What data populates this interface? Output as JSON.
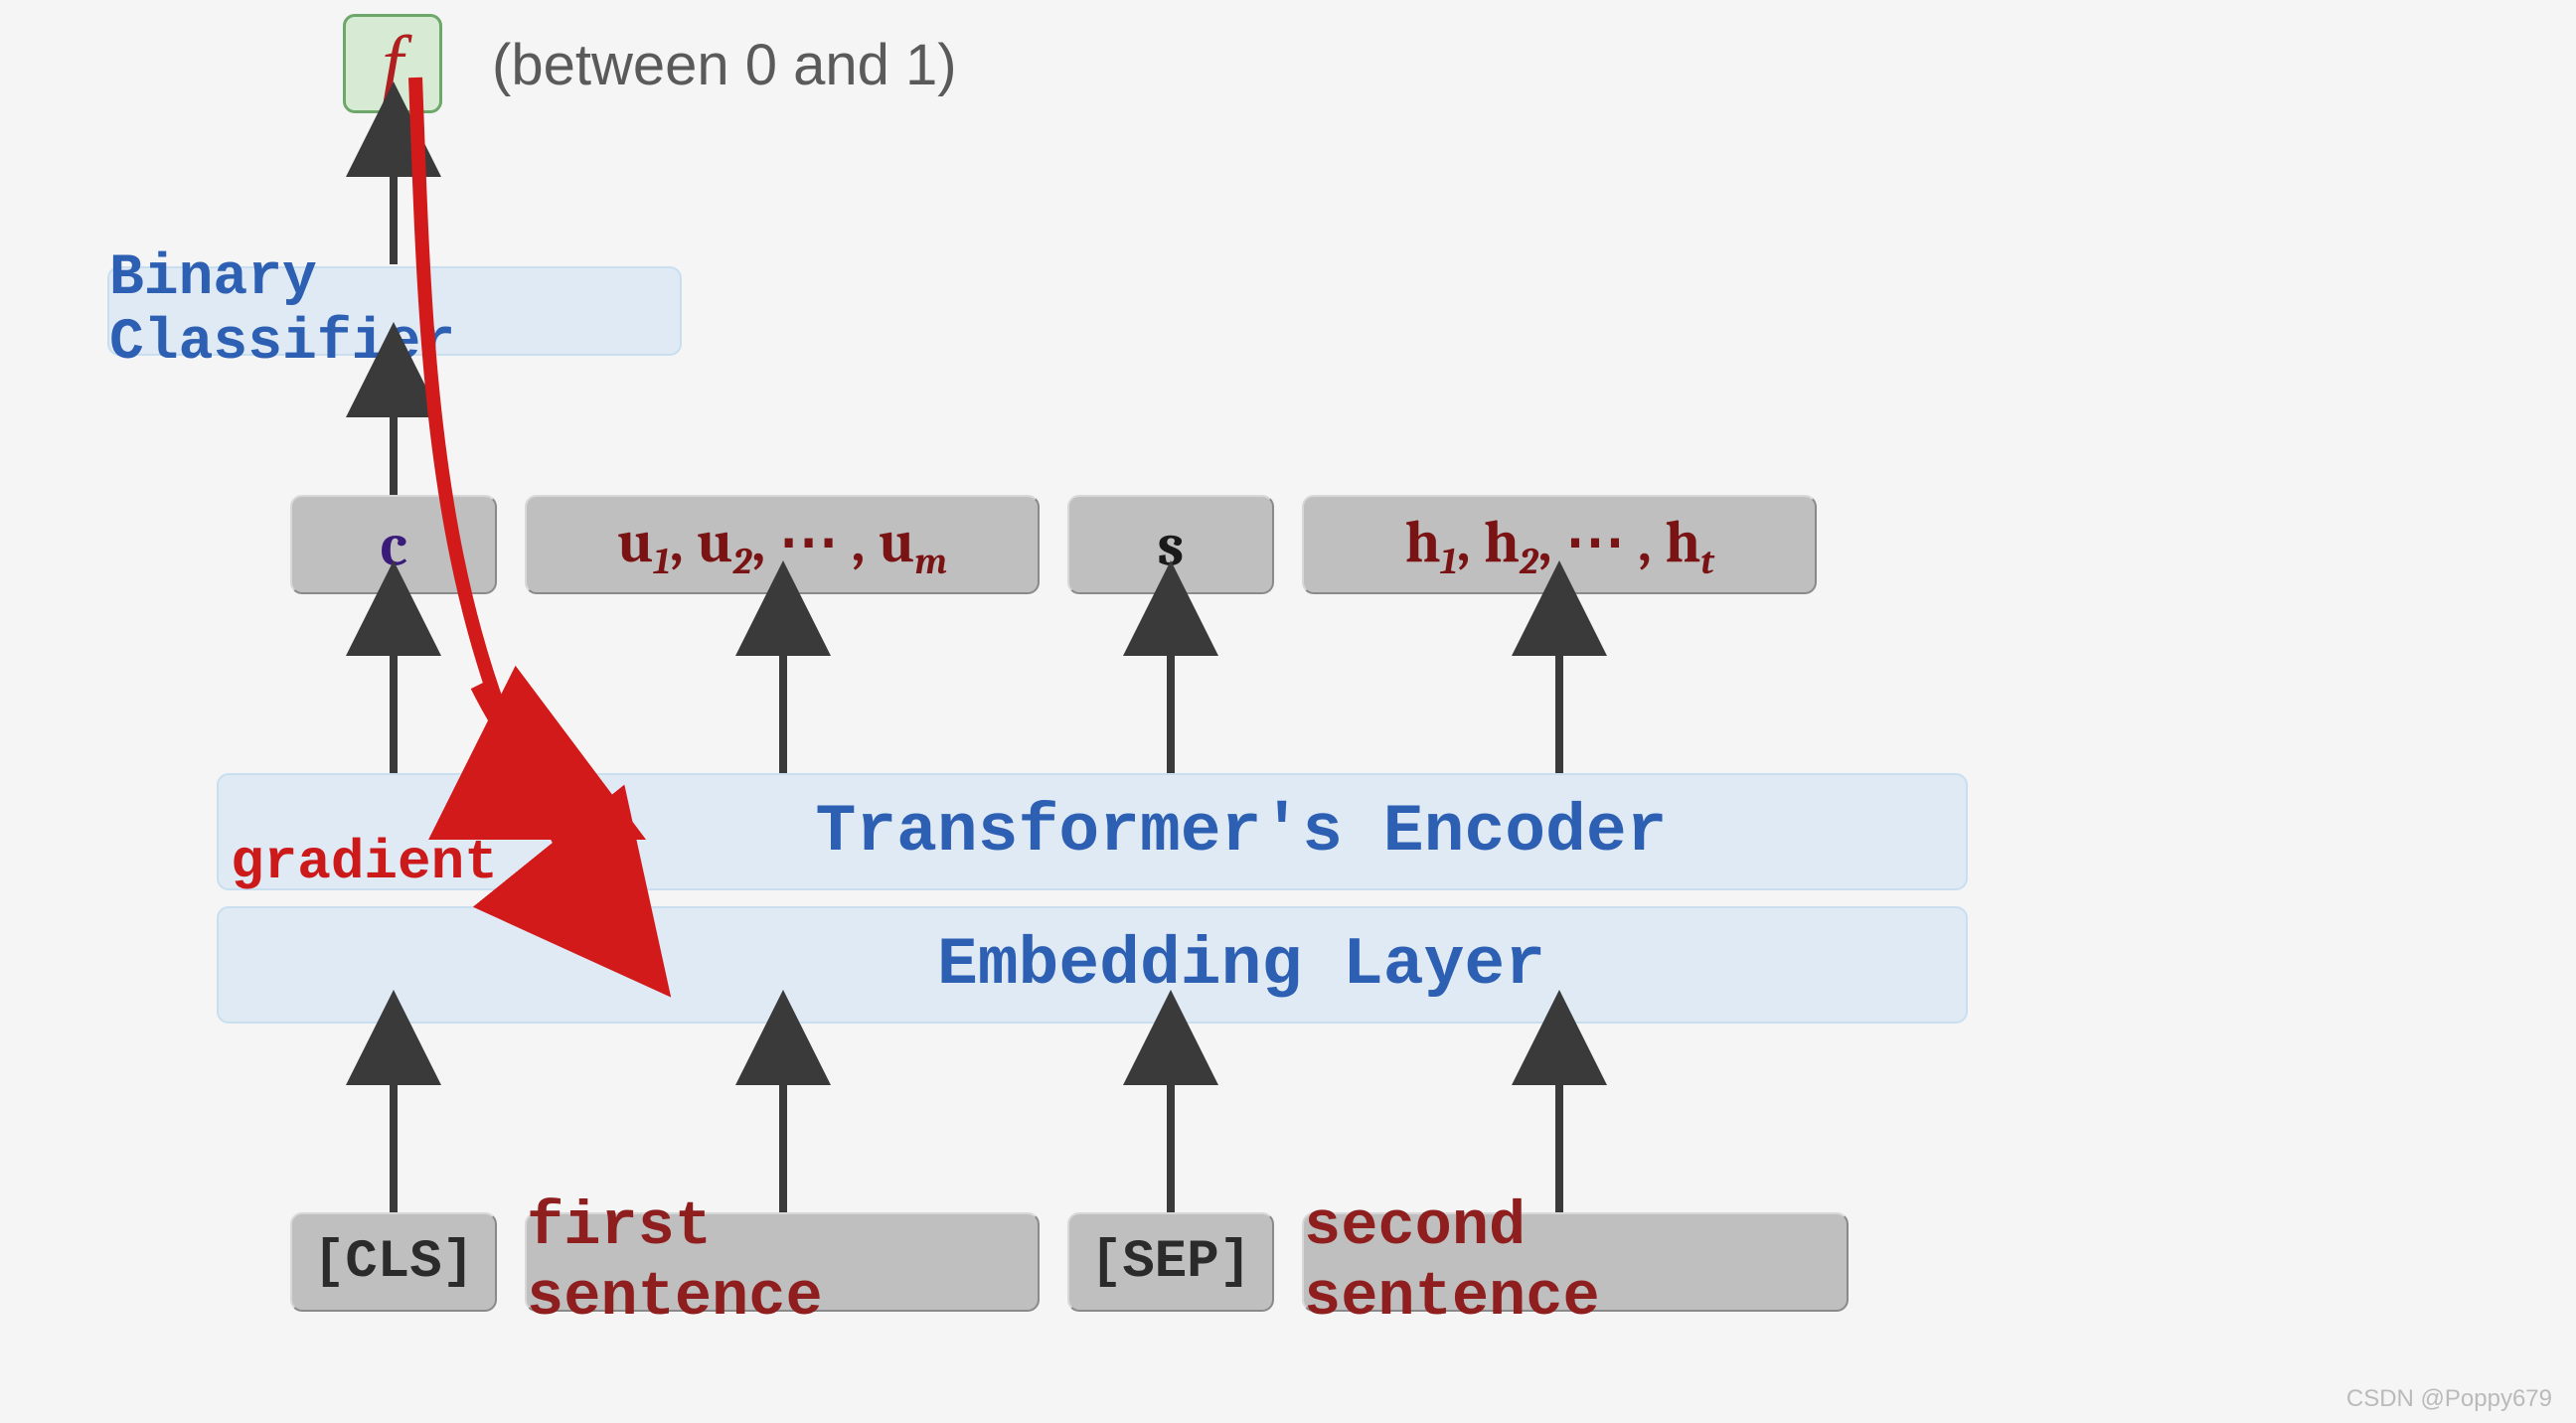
{
  "output": {
    "symbol": "f",
    "annotation": "(between 0 and 1)"
  },
  "classifier": "Binary Classifier",
  "hidden": {
    "c": "c",
    "u_html": "<b>u</b><sub>1</sub>, <b>u</b><sub>2</sub>, ⋯ , <b>u</b><sub>m</sub>",
    "s": "s",
    "h_html": "<b>h</b><sub>1</sub>, <b>h</b><sub>2</sub>, ⋯ , <b>h</b><sub>t</sub>"
  },
  "encoder": "Transformer's Encoder",
  "embedding": "Embedding Layer",
  "inputs": {
    "cls": "[CLS]",
    "first": "first sentence",
    "sep": "[SEP]",
    "second": "second sentence"
  },
  "gradient_label": "gradient",
  "watermark": "CSDN @Poppy679",
  "colors": {
    "box_gray": "#bfbfbf",
    "box_blue": "#dfeaf5",
    "box_green": "#d6ead4",
    "text_blue": "#2d5fb3",
    "text_red": "#8f1f1f",
    "text_purple": "#3b1b7a",
    "arrow_red": "#d21a1a"
  }
}
